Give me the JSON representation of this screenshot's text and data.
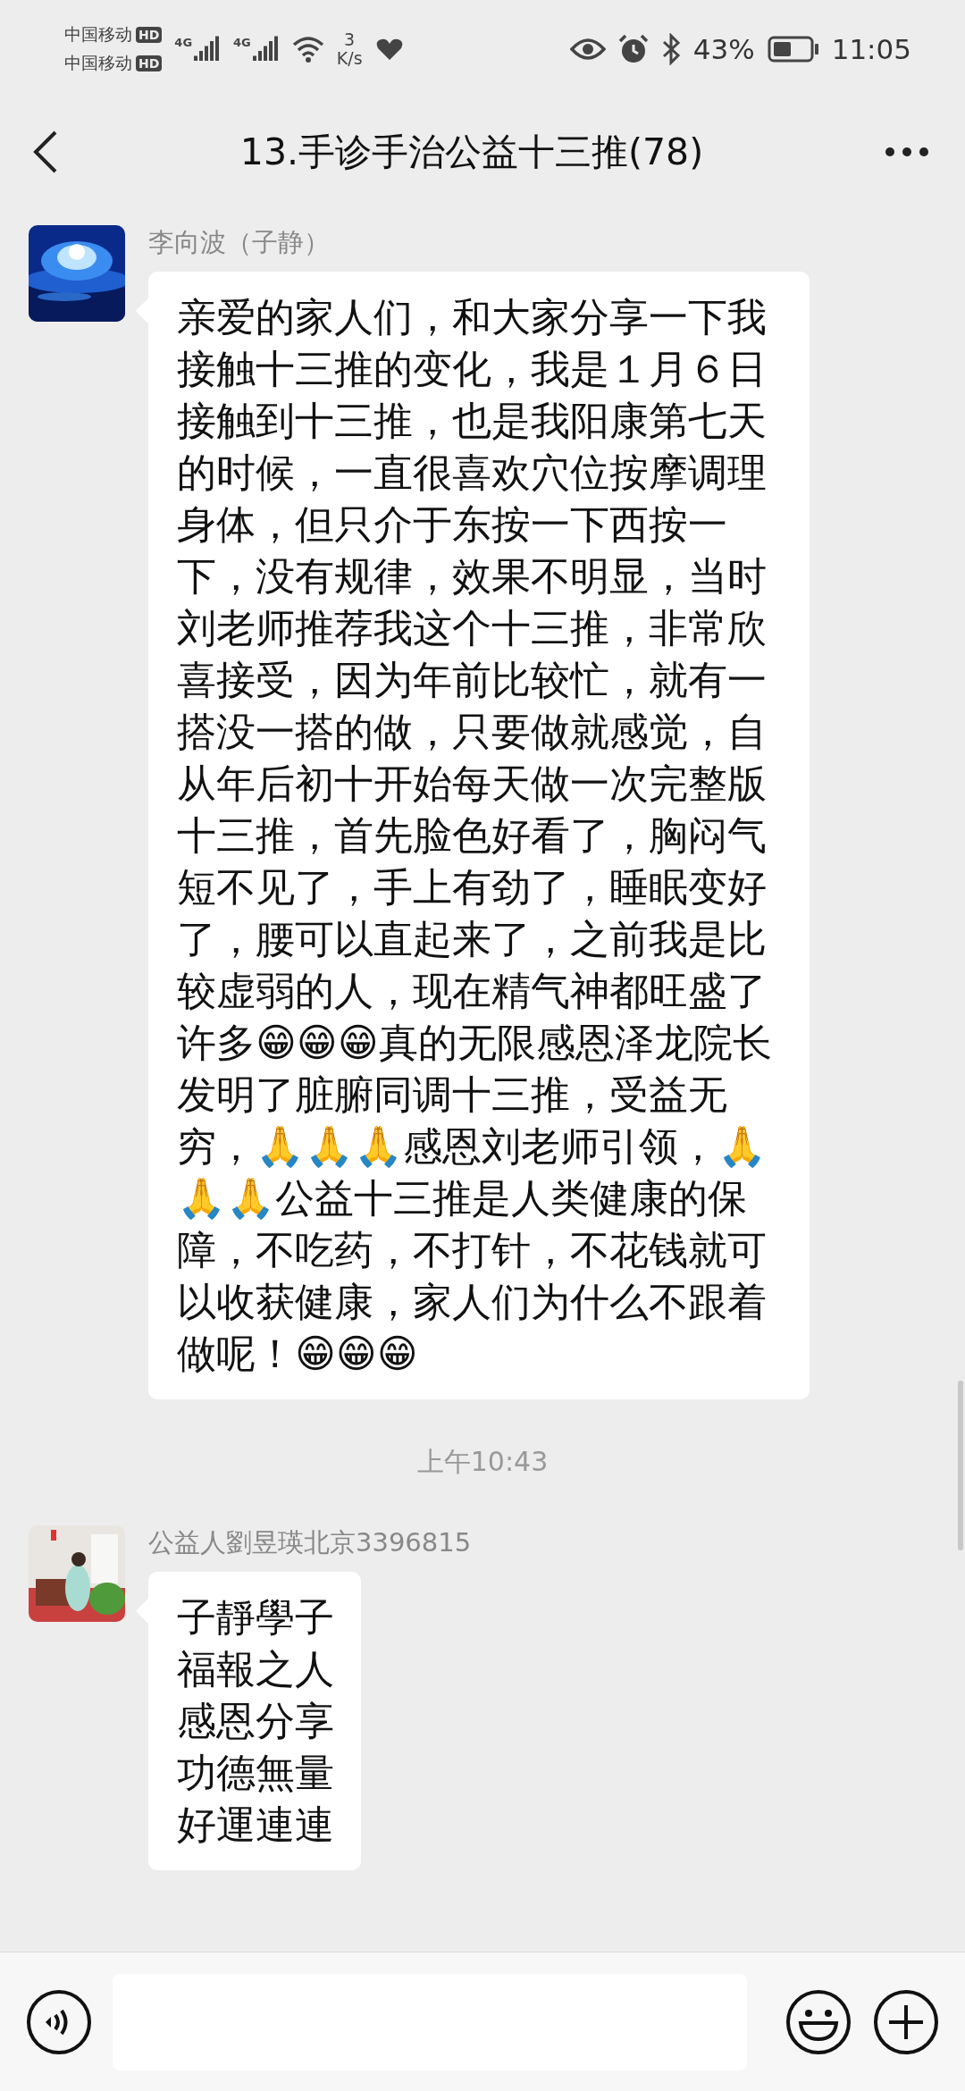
{
  "status_bar": {
    "carriers": [
      {
        "name": "中国移动",
        "badge": "HD"
      },
      {
        "name": "中国移动",
        "badge": "HD"
      }
    ],
    "networks": [
      "4G",
      "4G"
    ],
    "speed_value": "3",
    "speed_unit": "K/s",
    "battery": "43%",
    "time": "11:05"
  },
  "header": {
    "title": "13.手诊手治公益十三推(78)"
  },
  "messages": [
    {
      "kind": "message",
      "sender": "李向波（子静）",
      "text": "亲爱的家人们，和大家分享一下我接触十三推的变化，我是１月６日接触到十三推，也是我阳康第七天的时候，一直很喜欢穴位按摩调理身体，但只介于东按一下西按一下，没有规律，效果不明显，当时刘老师推荐我这个十三推，非常欣喜接受，因为年前比较忙，就有一搭没一搭的做，只要做就感觉，自从年后初十开始每天做一次完整版十三推，首先脸色好看了，胸闷气短不见了，手上有劲了，睡眠变好了，腰可以直起来了，之前我是比较虚弱的人，现在精气神都旺盛了许多😁😁😁真的无限感恩泽龙院长发明了脏腑同调十三推，受益无穷，🙏🙏🙏感恩刘老师引领，🙏🙏🙏公益十三推是人类健康的保障，不吃药，不打针，不花钱就可以收获健康，家人们为什么不跟着做呢！😁😁😁"
    },
    {
      "kind": "timestamp",
      "text": "上午10:43"
    },
    {
      "kind": "message",
      "sender": "公益人劉昱瑛北京3396815",
      "lines": [
        "子靜學子",
        "福報之人",
        "感恩分享",
        "功德無量",
        "好運連連"
      ]
    }
  ]
}
